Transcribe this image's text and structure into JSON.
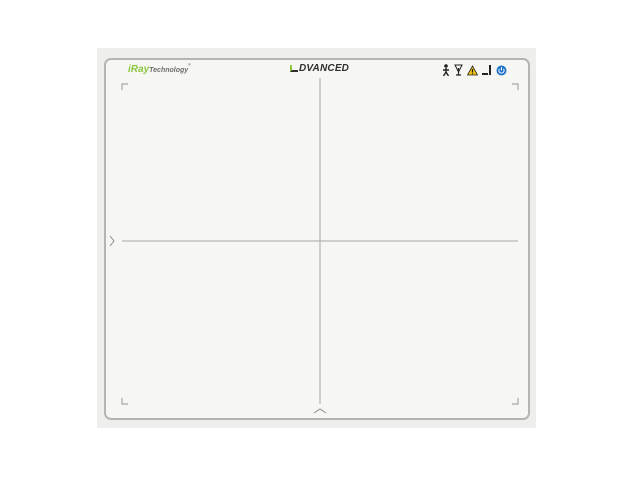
{
  "brand": {
    "name_part1": "i",
    "name_part2": "Ray",
    "name_part3": "Technology",
    "registered_mark": "®"
  },
  "model": {
    "label": "DVANCED"
  },
  "symbols": [
    "person-icon",
    "electrostatic-icon",
    "warning-icon",
    "info-icon",
    "power-icon"
  ],
  "colors": {
    "panel": "#f6f6f3",
    "border": "#b4b4b2",
    "brand_green": "#8cc63f",
    "grid_lines": "#a8a8a6",
    "power_blue": "#1f73c9"
  }
}
